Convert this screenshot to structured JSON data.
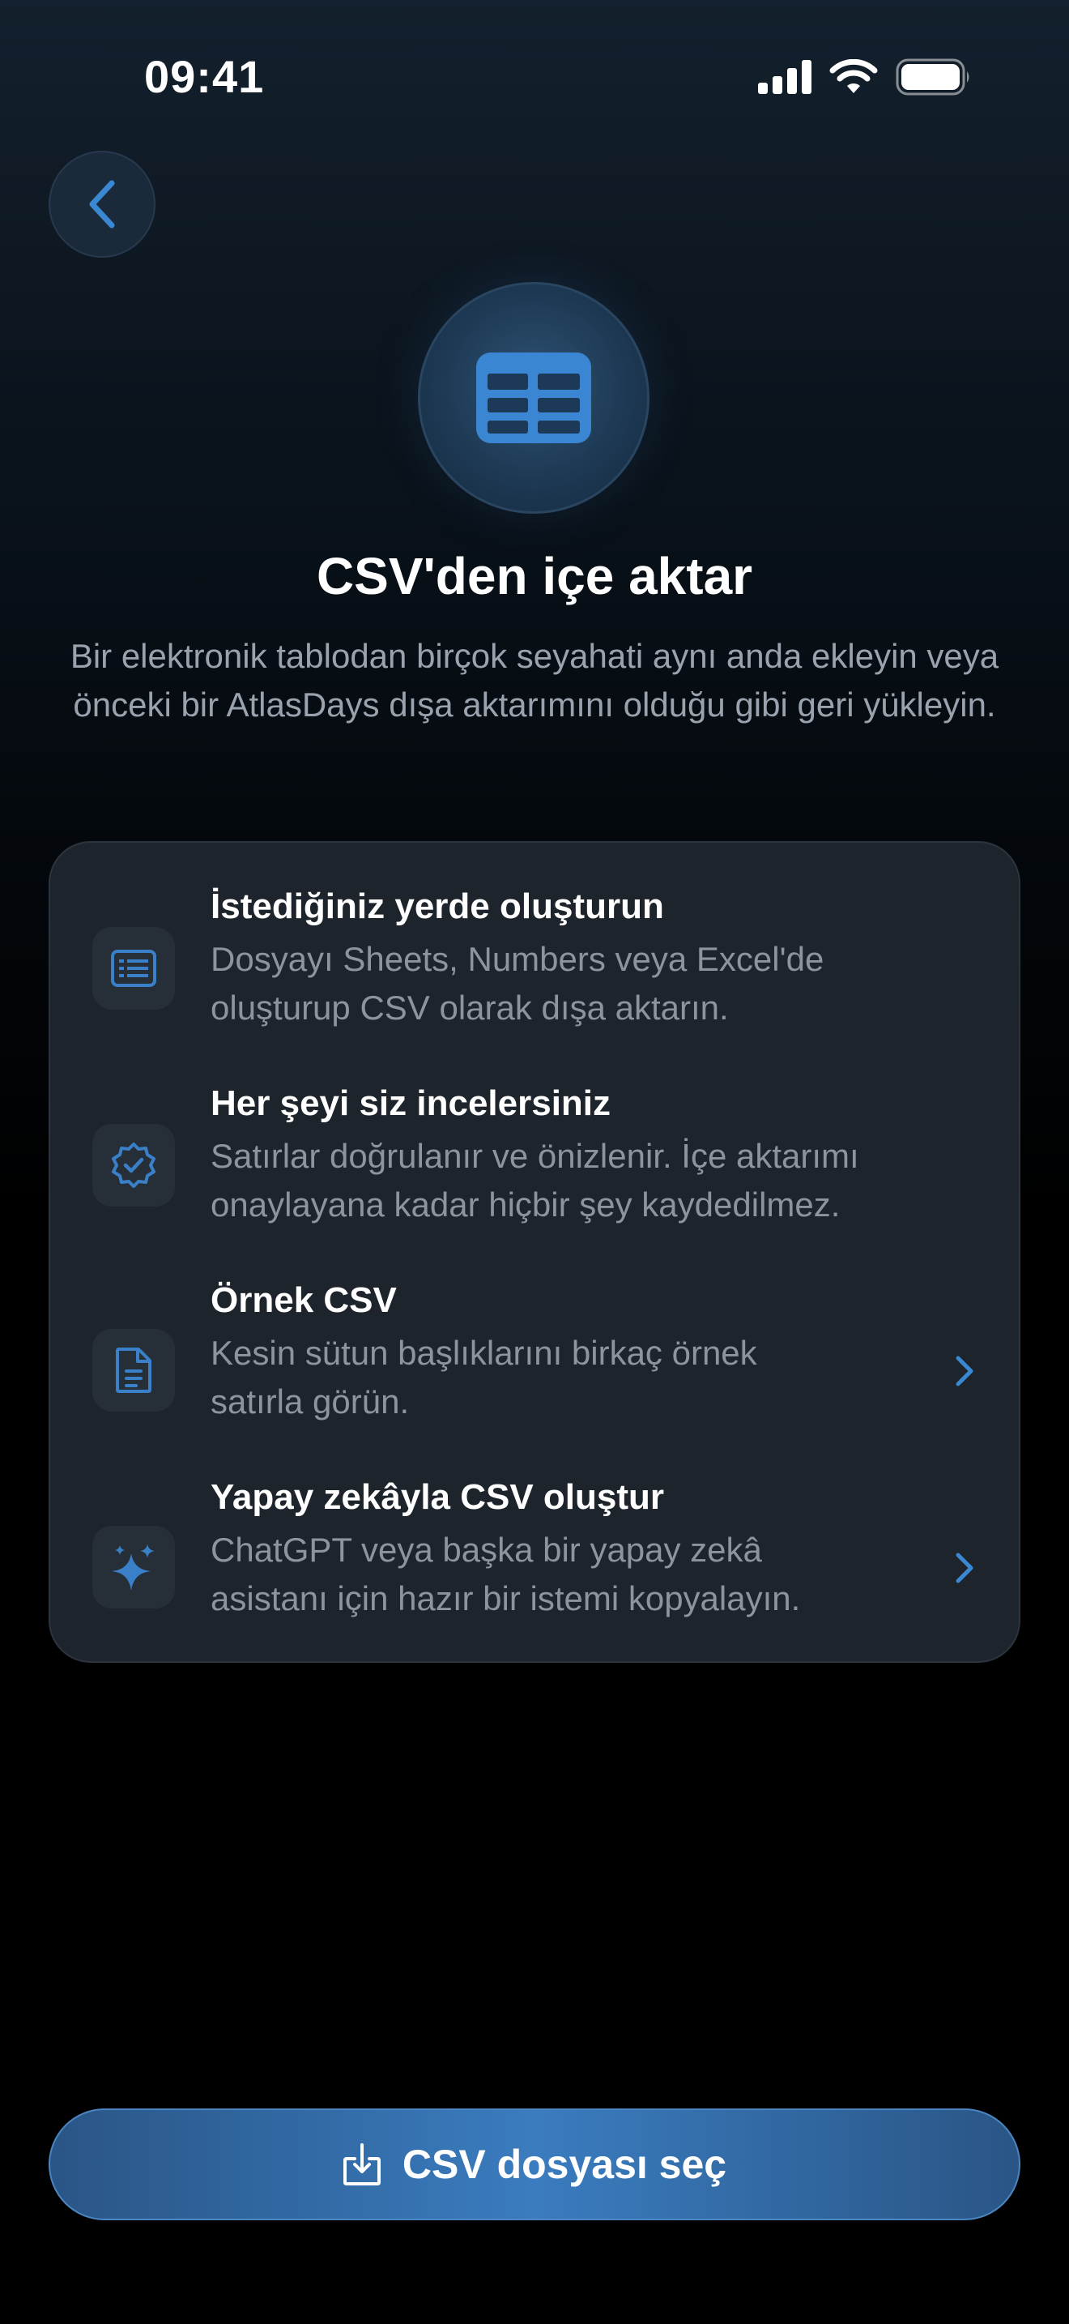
{
  "status_bar": {
    "time": "09:41"
  },
  "header": {
    "title": "CSV'den içe aktar",
    "subtitle": "Bir elektronik tablodan birçok seyahati aynı anda ekleyin veya önceki bir AtlasDays dışa aktarımını olduğu gibi geri yükleyin."
  },
  "card": {
    "items": [
      {
        "icon": "list-document-icon",
        "title": "İstediğiniz yerde oluşturun",
        "description_lines": [
          "Dosyayı Sheets, Numbers veya Excel'de",
          "oluşturup CSV olarak dışa aktarın."
        ],
        "has_chevron": false
      },
      {
        "icon": "verified-badge-icon",
        "title": "Her şeyi siz incelersiniz",
        "description_lines": [
          "Satırlar doğrulanır ve önizlenir. İçe aktarımı",
          "onaylayana kadar hiçbir şey kaydedilmez."
        ],
        "has_chevron": false
      },
      {
        "icon": "document-icon",
        "title": "Örnek CSV",
        "description_lines": [
          "Kesin sütun başlıklarını birkaç örnek",
          "satırla görün."
        ],
        "has_chevron": true
      },
      {
        "icon": "sparkles-icon",
        "title": "Yapay zekâyla CSV oluştur",
        "description_lines": [
          "ChatGPT veya başka bir yapay zekâ",
          "asistanı için hazır bir istemi kopyalayın."
        ],
        "has_chevron": true
      }
    ]
  },
  "cta": {
    "label": "CSV dosyası seç",
    "icon": "download-tray-icon"
  },
  "colors": {
    "accent": "#3a7cbf",
    "card_background": "#1e242b",
    "secondary_text": "#8c949d"
  }
}
